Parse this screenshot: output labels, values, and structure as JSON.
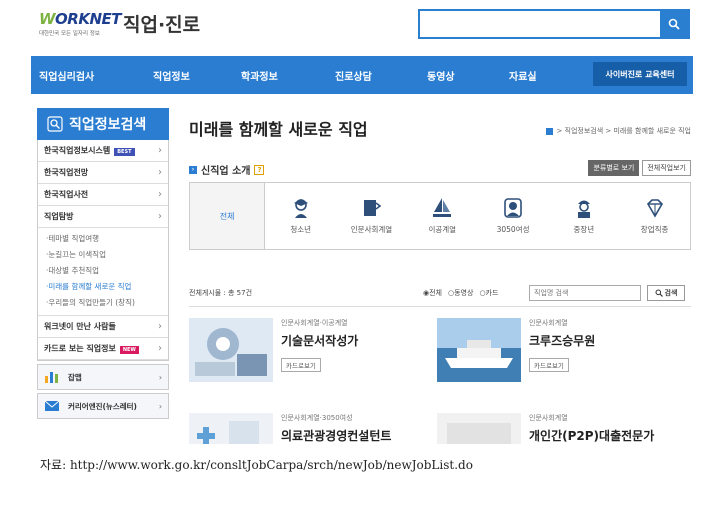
{
  "header": {
    "logo_text": "WORKNET",
    "logo_sub": "대한민국 모든 일자리 정보",
    "site_title": "직업·진로",
    "search_placeholder": ""
  },
  "nav": {
    "items": [
      "직업심리검사",
      "직업정보",
      "학과정보",
      "진로상담",
      "동영상",
      "자료실"
    ],
    "cyber_button": "사이버진로 교육센터"
  },
  "sidebar": {
    "title": "직업정보검색",
    "items": [
      {
        "label": "한국직업정보시스템",
        "badge": "BEST"
      },
      {
        "label": "한국직업전망",
        "badge": ""
      },
      {
        "label": "한국직업사전",
        "badge": ""
      },
      {
        "label": "직업탐방",
        "badge": ""
      }
    ],
    "sub_items": [
      "·테마별 직업여행",
      "·눈길끄는 이색직업",
      "·대상별 추천직업",
      "·미래를 함께할 새로운 직업",
      "·우리들의 직업만들기 (창직)"
    ],
    "more_items": [
      {
        "label": "워크넷이 만난 사람들",
        "badge": ""
      },
      {
        "label": "카드로 보는 직업정보",
        "badge": "NEW"
      }
    ],
    "boxes": [
      "잡맵",
      "커리어엔진(뉴스레터)"
    ]
  },
  "main": {
    "page_title": "미래를 함께할 새로운 직업",
    "breadcrumb": "> 직업정보검색 > 미래를 함께할 새로운 직업",
    "section_title": "신직업 소개",
    "btn_category_view": "분류별로 보기",
    "btn_all_view": "전체직업보기",
    "categories": [
      "전체",
      "청소년",
      "인문사회계열",
      "이공계열",
      "3050여성",
      "중장년",
      "창업직종"
    ],
    "total_text": "전체게시물 : 총 57건",
    "radio_options": [
      "◉전체",
      "○동영상",
      "○카드"
    ],
    "search_placeholder": "직업명 검색",
    "search_button": "검색",
    "cards": [
      {
        "meta": "인문사회계열·이공계열",
        "name": "기술문서작성가",
        "button": "카드로보기"
      },
      {
        "meta": "인문사회계열",
        "name": "크루즈승무원",
        "button": "카드로보기"
      },
      {
        "meta": "인문사회계열·3050여성",
        "name": "의료관광경영컨설턴트",
        "button": ""
      },
      {
        "meta": "인문사회계열",
        "name": "개인간(P2P)대출전문가",
        "button": ""
      }
    ]
  },
  "caption": "자료: http://www.work.go.kr/consltJobCarpa/srch/newJob/newJobList.do",
  "colors": {
    "brand_blue": "#2a7dd1",
    "dark_blue": "#175ea8"
  }
}
